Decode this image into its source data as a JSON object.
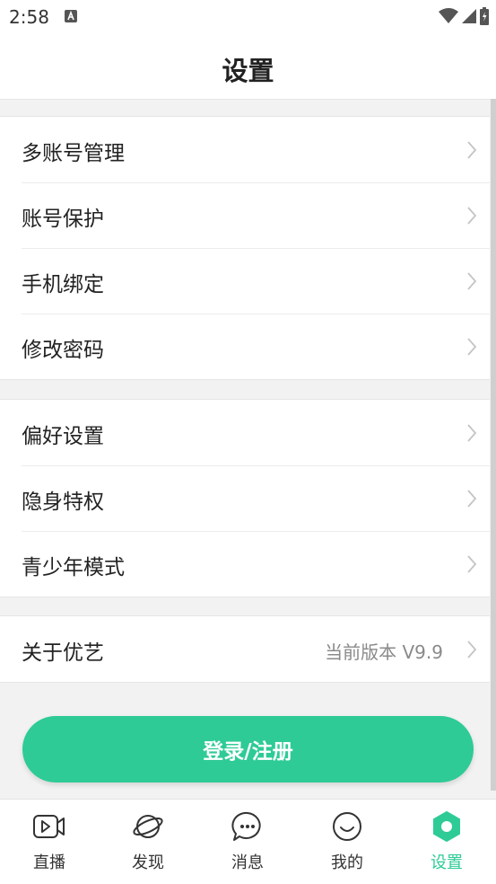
{
  "status_bar": {
    "time": "2:58"
  },
  "header": {
    "title": "设置"
  },
  "groups": [
    {
      "items": [
        {
          "label": "多账号管理"
        },
        {
          "label": "账号保护"
        },
        {
          "label": "手机绑定"
        },
        {
          "label": "修改密码"
        }
      ]
    },
    {
      "items": [
        {
          "label": "偏好设置"
        },
        {
          "label": "隐身特权"
        },
        {
          "label": "青少年模式"
        }
      ]
    },
    {
      "items": [
        {
          "label": "关于优艺",
          "value": "当前版本 V9.9"
        }
      ]
    }
  ],
  "login_button": {
    "label": "登录/注册"
  },
  "tabbar": {
    "accent_color": "#2ecb96",
    "tabs": [
      {
        "label": "直播",
        "icon": "live-video-icon"
      },
      {
        "label": "发现",
        "icon": "planet-icon"
      },
      {
        "label": "消息",
        "icon": "chat-bubble-icon"
      },
      {
        "label": "我的",
        "icon": "smiley-icon"
      },
      {
        "label": "设置",
        "icon": "settings-hexagon-icon",
        "active": true
      }
    ]
  }
}
